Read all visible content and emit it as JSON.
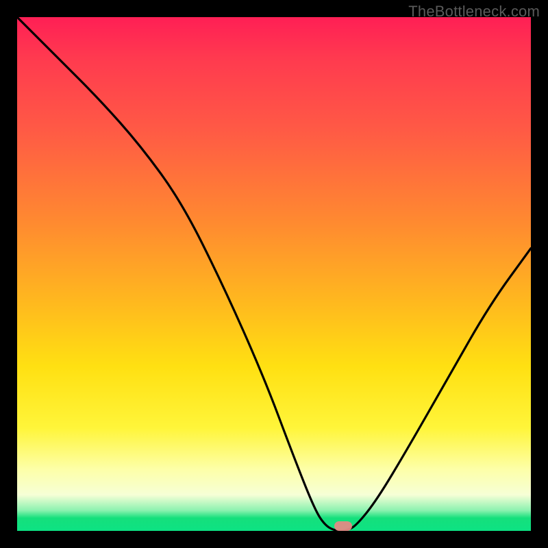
{
  "attribution": "TheBottleneck.com",
  "colors": {
    "frame": "#000000",
    "gradient_top": "#ff1f55",
    "gradient_mid1": "#ff8a30",
    "gradient_mid2": "#ffe012",
    "gradient_bottom": "#0de283",
    "curve": "#000000",
    "marker": "#e38a85"
  },
  "chart_data": {
    "type": "line",
    "title": "",
    "xlabel": "",
    "ylabel": "",
    "xlim": [
      0,
      100
    ],
    "ylim": [
      0,
      100
    ],
    "series": [
      {
        "name": "bottleneck-curve",
        "x": [
          0,
          8,
          16,
          24,
          32,
          40,
          48,
          54,
          58,
          60,
          62,
          64,
          66,
          70,
          76,
          84,
          92,
          100
        ],
        "values": [
          100,
          92,
          84,
          75,
          64,
          48,
          30,
          14,
          4,
          1,
          0,
          0,
          1,
          6,
          16,
          30,
          44,
          55
        ]
      }
    ],
    "annotations": [
      {
        "name": "optimal-marker",
        "x": 63.5,
        "y": 1
      }
    ]
  }
}
